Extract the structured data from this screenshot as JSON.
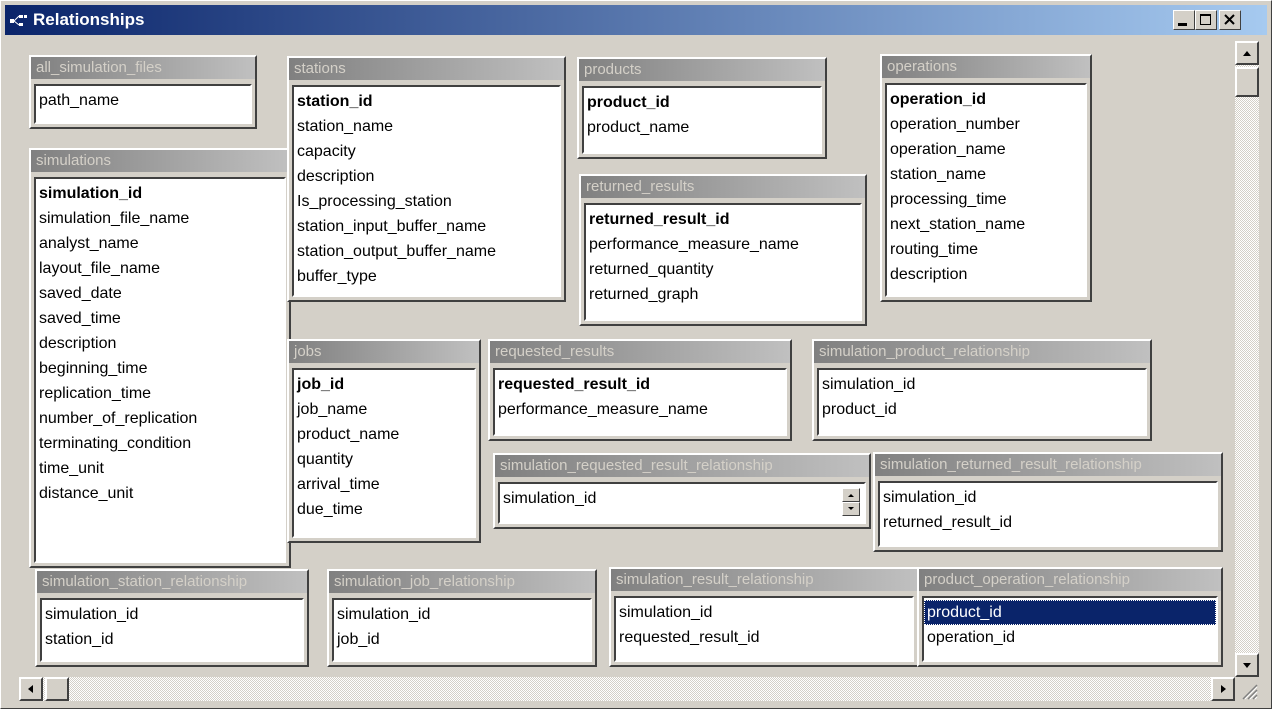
{
  "window": {
    "title": "Relationships"
  },
  "tables": [
    {
      "name": "all_simulation_files",
      "fields": [
        {
          "label": "path_name"
        }
      ]
    },
    {
      "name": "simulations",
      "fields": [
        {
          "label": "simulation_id"
        },
        {
          "label": "simulation_file_name"
        },
        {
          "label": "analyst_name"
        },
        {
          "label": "layout_file_name"
        },
        {
          "label": "saved_date"
        },
        {
          "label": "saved_time"
        },
        {
          "label": "description"
        },
        {
          "label": "beginning_time"
        },
        {
          "label": "replication_time"
        },
        {
          "label": "number_of_replication"
        },
        {
          "label": "terminating_condition"
        },
        {
          "label": "time_unit"
        },
        {
          "label": "distance_unit"
        }
      ]
    },
    {
      "name": "stations",
      "fields": [
        {
          "label": "station_id"
        },
        {
          "label": "station_name"
        },
        {
          "label": "capacity"
        },
        {
          "label": "description"
        },
        {
          "label": "Is_processing_station"
        },
        {
          "label": "station_input_buffer_name"
        },
        {
          "label": "station_output_buffer_name"
        },
        {
          "label": "buffer_type"
        }
      ]
    },
    {
      "name": "products",
      "fields": [
        {
          "label": "product_id"
        },
        {
          "label": "product_name"
        }
      ]
    },
    {
      "name": "returned_results",
      "fields": [
        {
          "label": "returned_result_id"
        },
        {
          "label": "performance_measure_name"
        },
        {
          "label": "returned_quantity"
        },
        {
          "label": "returned_graph"
        }
      ]
    },
    {
      "name": "operations",
      "fields": [
        {
          "label": "operation_id"
        },
        {
          "label": "operation_number"
        },
        {
          "label": "operation_name"
        },
        {
          "label": "station_name"
        },
        {
          "label": "processing_time"
        },
        {
          "label": "next_station_name"
        },
        {
          "label": "routing_time"
        },
        {
          "label": "description"
        }
      ]
    },
    {
      "name": "jobs",
      "fields": [
        {
          "label": "job_id"
        },
        {
          "label": "job_name"
        },
        {
          "label": "product_name"
        },
        {
          "label": "quantity"
        },
        {
          "label": "arrival_time"
        },
        {
          "label": "due_time"
        }
      ]
    },
    {
      "name": "requested_results",
      "fields": [
        {
          "label": "requested_result_id"
        },
        {
          "label": "performance_measure_name"
        }
      ]
    },
    {
      "name": "simulation_product_relationship",
      "fields": [
        {
          "label": "simulation_id"
        },
        {
          "label": "product_id"
        }
      ]
    },
    {
      "name": "simulation_requested_result_relationship",
      "fields": [
        {
          "label": "simulation_id"
        }
      ]
    },
    {
      "name": "simulation_returned_result_relationship",
      "fields": [
        {
          "label": "simulation_id"
        },
        {
          "label": "returned_result_id"
        }
      ]
    },
    {
      "name": "simulation_station_relationship",
      "fields": [
        {
          "label": "simulation_id"
        },
        {
          "label": "station_id"
        }
      ]
    },
    {
      "name": "simulation_job_relationship",
      "fields": [
        {
          "label": "simulation_id"
        },
        {
          "label": "job_id"
        }
      ]
    },
    {
      "name": "simulation_result_relationship",
      "fields": [
        {
          "label": "simulation_id"
        },
        {
          "label": "requested_result_id"
        }
      ]
    },
    {
      "name": "product_operation_relationship",
      "fields": [
        {
          "label": "product_id"
        },
        {
          "label": "operation_id"
        }
      ]
    }
  ],
  "selected_field": "product_operation_relationship.product_id",
  "colors": {
    "title_bar_start": "#0a246a",
    "title_bar_end": "#a6caf0",
    "selection": "#0a246a",
    "table_header": "#808080"
  }
}
